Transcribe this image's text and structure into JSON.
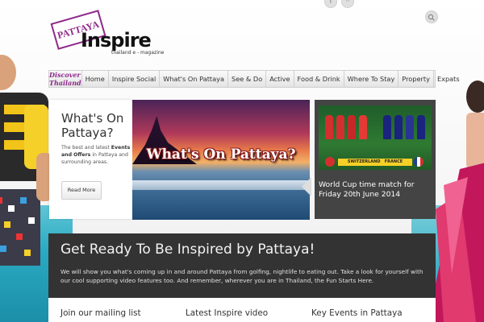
{
  "page": {
    "logo": {
      "stamp": "PATTAYA",
      "word": "Inspire",
      "tagline": "thailand e - magazine"
    },
    "nav": {
      "brand": "Discover Thailand",
      "items": [
        "Home",
        "Inspire Social",
        "What's On Pattaya",
        "See & Do",
        "Active",
        "Food & Drink",
        "Where To Stay",
        "Property",
        "Expats"
      ]
    },
    "intro": {
      "heading": "What's On Pattaya?",
      "text_before": "The best and latest ",
      "text_bold": "Events and Offers",
      "text_after": " in Pattaya and surrounding areas.",
      "button": "Read More"
    },
    "hero": {
      "overlay_text": "What's On Pattaya?"
    },
    "news": {
      "title": "World Cup time match for Friday 20th June 2014",
      "team_left": "SWITZERLAND",
      "team_right": "FRANCE"
    },
    "ready": {
      "heading": "Get Ready To Be Inspired by Pattaya!",
      "body": "We will show you what's coming up in and around Pattaya from golfing, nightlife to eating out. Take a look for yourself with our cool supporting video features too. And remember, wherever you are in Thailand, the Fun Starts Here."
    },
    "columns": [
      "Join our mailing list",
      "Latest Inspire video",
      "Key Events in Pattaya"
    ],
    "colors": {
      "accent_purple": "#8e2a8a",
      "panel_dark": "#333333",
      "news_dark": "#444444"
    }
  }
}
